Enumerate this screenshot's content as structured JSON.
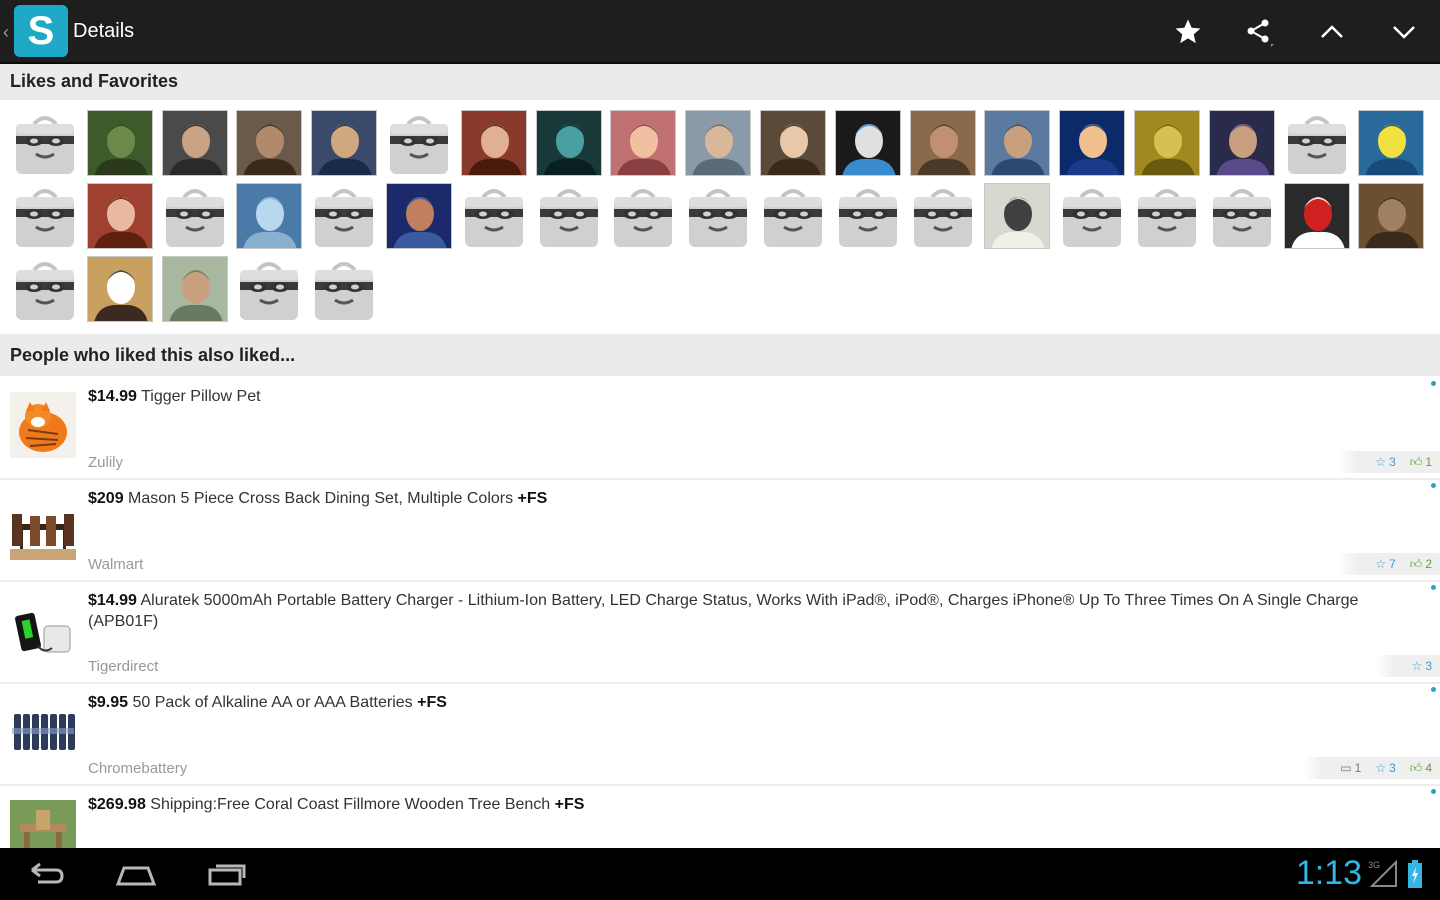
{
  "app": {
    "title": "Details",
    "logo_letter": "S",
    "accent": "#1fa9c6"
  },
  "sections": {
    "likes": "Likes and Favorites",
    "also_liked": "People who liked this also liked..."
  },
  "avatars": [
    "default",
    "photo",
    "photo",
    "photo",
    "photo",
    "default",
    "photo",
    "photo",
    "photo",
    "photo",
    "photo",
    "photo",
    "photo",
    "photo",
    "photo",
    "photo",
    "photo",
    "default",
    "photo",
    "default",
    "photo",
    "default",
    "photo",
    "default",
    "photo",
    "default",
    "default",
    "default",
    "default",
    "default",
    "default",
    "default",
    "photo",
    "default",
    "default",
    "default",
    "photo",
    "photo",
    "default",
    "photo",
    "photo",
    "default",
    "default"
  ],
  "items": [
    {
      "price": "$14.99",
      "title": "Tigger Pillow Pet",
      "store": "Zulily",
      "comments": null,
      "favorites": "3",
      "likes": "1"
    },
    {
      "price": "$209",
      "title": "Mason 5 Piece Cross Back Dining Set, Multiple Colors",
      "fs": "+FS",
      "store": "Walmart",
      "comments": null,
      "favorites": "7",
      "likes": "2"
    },
    {
      "price": "$14.99",
      "title": "Aluratek 5000mAh Portable Battery Charger - Lithium-Ion Battery, LED Charge Status, Works With iPad®, iPod®, Charges iPhone® Up To Three Times On A Single Charge (APB01F)",
      "store": "Tigerdirect",
      "comments": null,
      "favorites": "3",
      "likes": null
    },
    {
      "price": "$9.95",
      "title": "50 Pack of Alkaline AA or AAA Batteries",
      "fs": "+FS",
      "store": "Chromebattery",
      "comments": "1",
      "favorites": "3",
      "likes": "4"
    },
    {
      "price": "$269.98",
      "title": "Shipping:Free Coral Coast Fillmore Wooden Tree Bench",
      "fs": "+FS",
      "store": "",
      "comments": null,
      "favorites": null,
      "likes": null
    }
  ],
  "status": {
    "time": "1:13",
    "signal": "3G"
  },
  "colors": {
    "favorite": "#3b9ec7",
    "like": "#5aa33a",
    "clock": "#33b5e5"
  }
}
